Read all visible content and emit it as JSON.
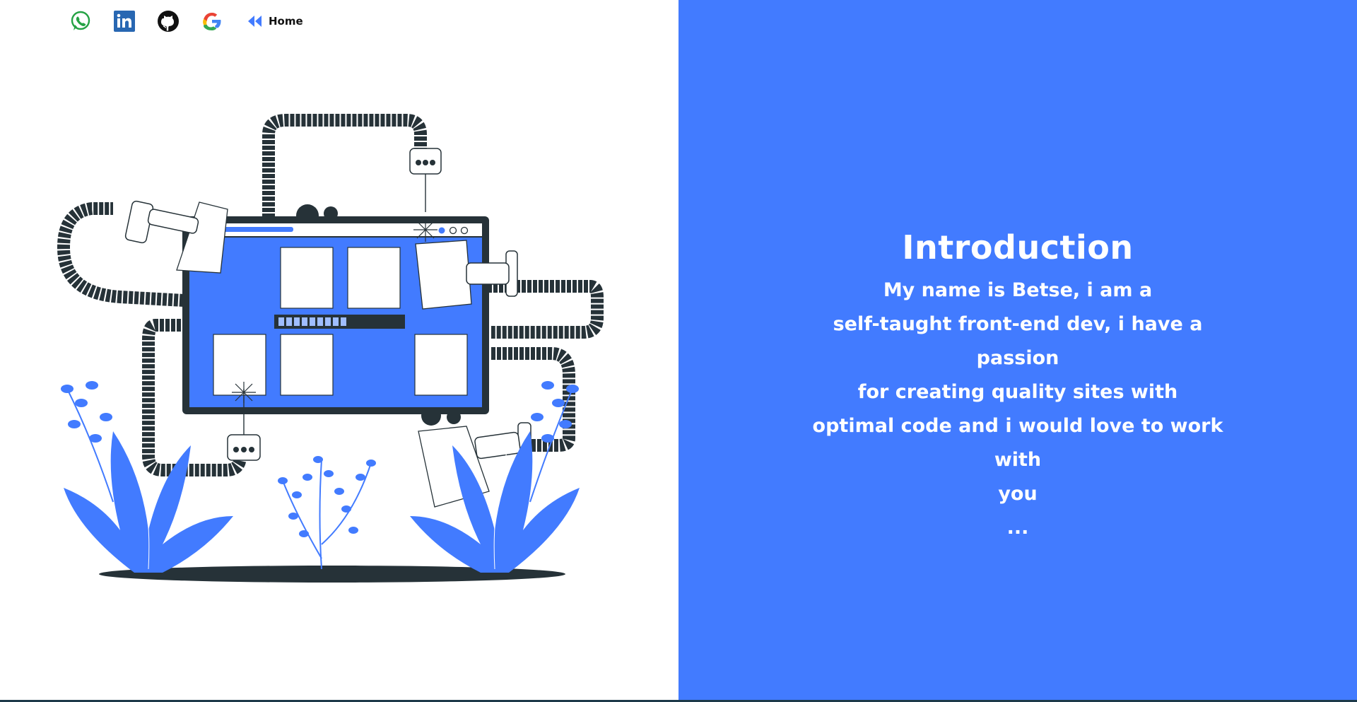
{
  "nav": {
    "icons": [
      "whatsapp-icon",
      "linkedin-icon",
      "github-icon",
      "google-icon"
    ],
    "home_icon": "rewind-icon",
    "home_label": "Home"
  },
  "intro": {
    "title": "Introduction",
    "lines": [
      "My name is Betse, i am a",
      "self-taught front-end dev, i have a passion",
      "for creating quality sites with",
      "optimal code and i would love to work with",
      "you",
      "..."
    ]
  },
  "colors": {
    "accent": "#427bff",
    "dark": "#263238",
    "whatsapp": "#25a244",
    "linkedin": "#2867b2"
  }
}
